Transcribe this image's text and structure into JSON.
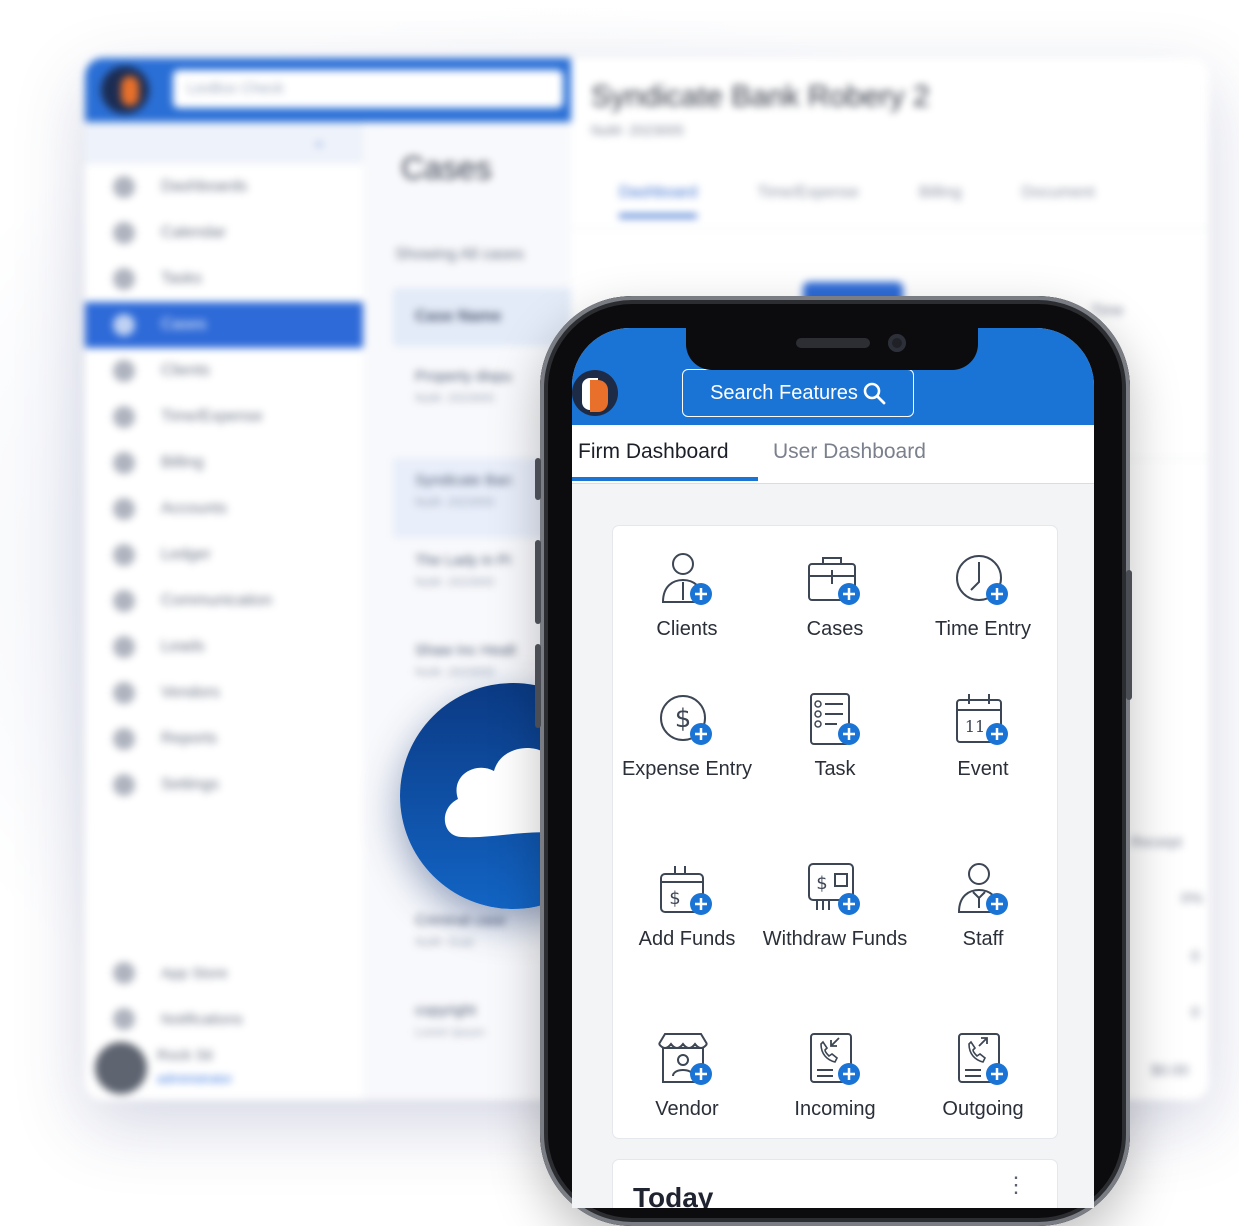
{
  "desktop": {
    "search_placeholder": "LexBox Check",
    "sidebar": {
      "collapse_icon": "«",
      "items": [
        {
          "label": "Dashboards",
          "icon": "home-icon"
        },
        {
          "label": "Calendar",
          "icon": "calendar-icon"
        },
        {
          "label": "Tasks",
          "icon": "tasks-icon"
        },
        {
          "label": "Cases",
          "icon": "briefcase-icon",
          "active": true
        },
        {
          "label": "Clients",
          "icon": "user-icon"
        },
        {
          "label": "Time/Expense",
          "icon": "clock-icon"
        },
        {
          "label": "Billing",
          "icon": "billing-icon"
        },
        {
          "label": "Accounts",
          "icon": "accounts-icon"
        },
        {
          "label": "Ledger",
          "icon": "ledger-icon"
        },
        {
          "label": "Communication",
          "icon": "phone-icon"
        },
        {
          "label": "Leads",
          "icon": "leads-icon"
        },
        {
          "label": "Vendors",
          "icon": "vendors-icon"
        },
        {
          "label": "Reports",
          "icon": "reports-icon"
        },
        {
          "label": "Settings",
          "icon": "gear-icon"
        }
      ],
      "app_store": "App Store",
      "notifications": "Notifications",
      "user_name": "Rock Sti",
      "user_role": "administrator"
    },
    "cases": {
      "title": "Cases",
      "showing": "Showing All cases",
      "column_header": "Case Name",
      "rows": [
        {
          "name": "Property dispu",
          "sub": "NuM- 2023000"
        },
        {
          "name": "Syndicate Ban",
          "sub": "NuM- 2023000"
        },
        {
          "name": "The Lady in Pi",
          "sub": "NuM- 2023000"
        },
        {
          "name": "Shaw Inc Healt",
          "sub": "NuM- 2023000"
        },
        {
          "name": "Criminal case",
          "sub": "NuM- Goal"
        },
        {
          "name": "copyright",
          "sub": "Lorem Ipsum"
        }
      ]
    },
    "main": {
      "title": "Syndicate Bank Robery 2",
      "subtitle": "NuM- 2023005",
      "tabs": [
        "Dashboard",
        "Time/Expense",
        "Billing",
        "Document"
      ],
      "right_labels": [
        "Time",
        "Receipt",
        "0%",
        "0",
        "0",
        "$0.00"
      ]
    }
  },
  "cloud_badge": {
    "icon": "cloud-check-icon",
    "check_color": "#1fb25a"
  },
  "mobile": {
    "header_color": "#1a74d6",
    "search_label": "Search Features",
    "tabs": {
      "firm": "Firm Dashboard",
      "user": "User Dashboard"
    },
    "features": [
      {
        "label": "Clients",
        "icon": "add-client-icon"
      },
      {
        "label": "Cases",
        "icon": "add-case-icon"
      },
      {
        "label": "Time Entry",
        "icon": "add-time-entry-icon"
      },
      {
        "label": "Expense Entry",
        "icon": "add-expense-icon"
      },
      {
        "label": "Task",
        "icon": "add-task-icon"
      },
      {
        "label": "Event",
        "icon": "add-event-icon"
      },
      {
        "label": "Add Funds",
        "icon": "add-funds-icon"
      },
      {
        "label": "Withdraw Funds",
        "icon": "withdraw-funds-icon"
      },
      {
        "label": "Staff",
        "icon": "add-staff-icon"
      },
      {
        "label": "Vendor",
        "icon": "add-vendor-icon"
      },
      {
        "label": "Incoming",
        "icon": "incoming-call-icon"
      },
      {
        "label": "Outgoing",
        "icon": "outgoing-call-icon"
      }
    ],
    "event_day": "11",
    "today_title": "Today",
    "kebab": "⋮"
  }
}
